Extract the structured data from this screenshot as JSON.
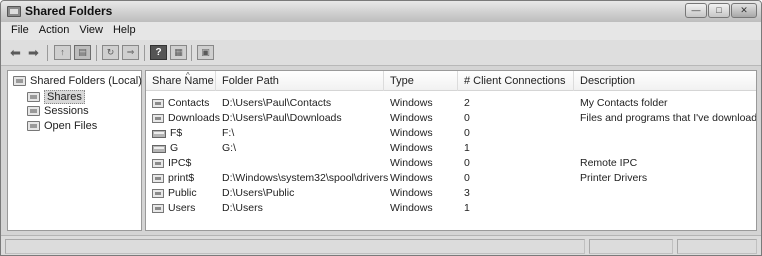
{
  "window": {
    "title": "Shared Folders",
    "icon": "shared-folders-icon",
    "controls": [
      "minimize",
      "maximize",
      "close"
    ]
  },
  "menu": [
    "File",
    "Action",
    "View",
    "Help"
  ],
  "toolbar": {
    "buttons": [
      "back-arrow-icon",
      "forward-arrow-icon",
      "up-icon",
      "show-hide-tree-icon",
      "refresh-icon",
      "export-list-icon",
      "help-icon",
      "properties-icon",
      "new-share-icon"
    ]
  },
  "tree": {
    "root": "Shared Folders (Local)",
    "items": [
      "Shares",
      "Sessions",
      "Open Files"
    ],
    "selected": "Shares"
  },
  "table": {
    "columns": [
      "Share Name",
      "Folder Path",
      "Type",
      "# Client Connections",
      "Description"
    ],
    "sorted_by": "Share Name",
    "rows": [
      {
        "name": "Contacts",
        "icon": "share-folder-icon",
        "path": "D:\\Users\\Paul\\Contacts",
        "type": "Windows",
        "connections": "2",
        "description": "My Contacts folder"
      },
      {
        "name": "Downloads",
        "icon": "share-folder-icon",
        "path": "D:\\Users\\Paul\\Downloads",
        "type": "Windows",
        "connections": "0",
        "description": "Files and programs that I've downloaded"
      },
      {
        "name": "F$",
        "icon": "share-drive-icon",
        "path": "F:\\",
        "type": "Windows",
        "connections": "0",
        "description": ""
      },
      {
        "name": "G",
        "icon": "share-drive-icon",
        "path": "G:\\",
        "type": "Windows",
        "connections": "1",
        "description": ""
      },
      {
        "name": "IPC$",
        "icon": "share-folder-icon",
        "path": "",
        "type": "Windows",
        "connections": "0",
        "description": "Remote IPC"
      },
      {
        "name": "print$",
        "icon": "share-folder-icon",
        "path": "D:\\Windows\\system32\\spool\\drivers",
        "type": "Windows",
        "connections": "0",
        "description": "Printer Drivers"
      },
      {
        "name": "Public",
        "icon": "share-folder-icon",
        "path": "D:\\Users\\Public",
        "type": "Windows",
        "connections": "3",
        "description": ""
      },
      {
        "name": "Users",
        "icon": "share-folder-icon",
        "path": "D:\\Users",
        "type": "Windows",
        "connections": "1",
        "description": ""
      }
    ]
  }
}
